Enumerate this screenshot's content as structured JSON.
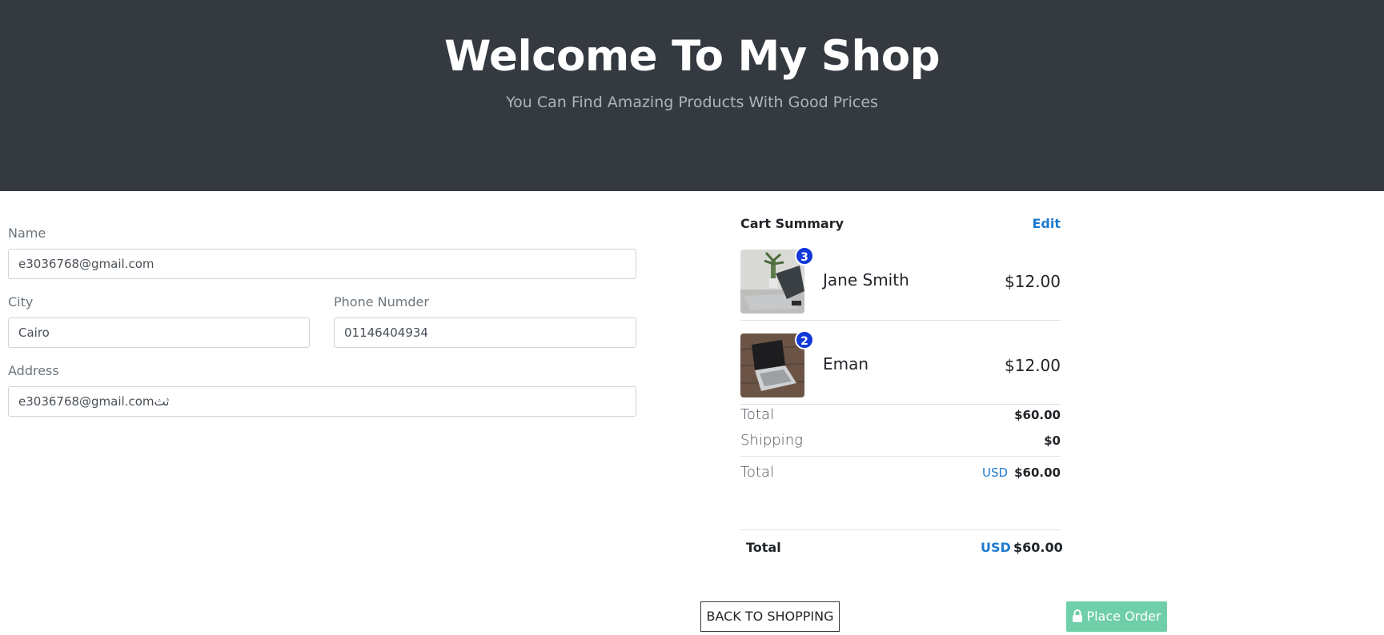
{
  "hero": {
    "title": "Welcome To My Shop",
    "subtitle": "You Can Find Amazing Products With Good Prices"
  },
  "form": {
    "name_label": "Name",
    "name_value": "e3036768@gmail.com",
    "city_label": "City",
    "city_value": "Cairo",
    "phone_label": "Phone Numder",
    "phone_value": "01146404934",
    "address_label": "Address",
    "address_value": "e3036768@gmail.comثث"
  },
  "cart": {
    "title": "Cart Summary",
    "edit_label": "Edit",
    "items": [
      {
        "name": "Jane Smith",
        "price": "$12.00",
        "quantity": "3",
        "image_icon": "laptop-desk-photo"
      },
      {
        "name": "Eman",
        "price": "$12.00",
        "quantity": "2",
        "image_icon": "laptop-wood-photo"
      }
    ],
    "subtotal_label": "Total",
    "subtotal_value": "$60.00",
    "shipping_label": "Shipping",
    "shipping_value": "$0",
    "total_label": "Total",
    "total_currency": "USD",
    "total_value": "$60.00"
  },
  "final": {
    "label": "Total",
    "currency": "USD",
    "value": "$60.00"
  },
  "actions": {
    "back_label": "BACK TO SHOPPING",
    "order_label": "Place Order"
  },
  "colors": {
    "hero_bg": "#343a40",
    "accent": "#1e7bd0",
    "badge": "#1238d8",
    "order_button": "#6fcfa8"
  }
}
